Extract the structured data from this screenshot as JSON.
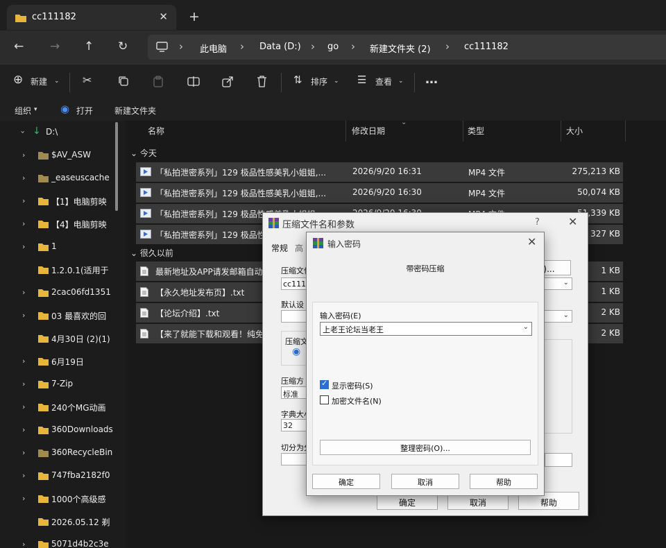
{
  "explorer": {
    "tab_title": "cc111182",
    "breadcrumbs": [
      "此电脑",
      "Data (D:)",
      "go",
      "新建文件夹 (2)",
      "cc111182"
    ],
    "commands": {
      "new": "新建",
      "sort": "排序",
      "view": "查看",
      "more": "…"
    },
    "subbar": {
      "organize": "组织",
      "open": "打开",
      "new_folder": "新建文件夹"
    },
    "tree": {
      "root": "D:\\",
      "items": [
        "$AV_ASW",
        "_easeuscache",
        "【1】电脑剪映",
        "【4】电脑剪映",
        "1",
        "1.2.0.1(适用于",
        "2cac06fd1351",
        "03 最喜欢的回",
        "4月30日 (2)(1)",
        "6月19日",
        "7-Zip",
        "240个MG动画",
        "360Downloads",
        "360RecycleBin",
        "747fba2182f0",
        "1000个高级感",
        "2026.05.12 剃",
        "5071d4b2c3e"
      ]
    },
    "columns": {
      "name": "名称",
      "date": "修改日期",
      "type": "类型",
      "size": "大小"
    },
    "groups": {
      "today": "今天",
      "older": "很久以前"
    },
    "today_files": [
      {
        "name": "「私拍泄密系列」129 极品性感美乳小姐姐,...",
        "date": "2026/9/20 16:31",
        "type": "MP4 文件",
        "size": "275,213 KB"
      },
      {
        "name": "「私拍泄密系列」129 极品性感美乳小姐姐,...",
        "date": "2026/9/20 16:30",
        "type": "MP4 文件",
        "size": "50,074 KB"
      },
      {
        "name": "「私拍泄密系列」129 极品性感美乳小姐姐,...",
        "date": "2026/9/20 16:30",
        "type": "MP4 文件",
        "size": "51,339 KB"
      },
      {
        "name": "「私拍泄密系列」129 极品性",
        "date": "",
        "type": "",
        "size": "327 KB"
      }
    ],
    "older_files": [
      {
        "name": "最新地址及APP请发邮箱自动",
        "size": "1 KB"
      },
      {
        "name": "【永久地址发布页】.txt",
        "size": "1 KB"
      },
      {
        "name": "【论坛介绍】.txt",
        "size": "2 KB"
      },
      {
        "name": "【来了就能下载和观看！纯免",
        "size": "2 KB"
      }
    ]
  },
  "archive_dialog": {
    "title": "压缩文件名和参数",
    "help": "?",
    "tabs": [
      "常规",
      "高"
    ],
    "labels": {
      "archive_name": "压缩文件",
      "name_value": "cc1111",
      "default": "默认设",
      "format": "压缩文",
      "method": "压缩方",
      "method_value": "标准",
      "dict": "字典大小",
      "dict_value": "32",
      "split": "切分为分"
    },
    "browse": "浏览(B)...",
    "ok": "确定",
    "cancel": "取消",
    "help_btn": "帮助"
  },
  "password_dialog": {
    "title": "输入密码",
    "heading": "带密码压缩",
    "input_label": "输入密码(E)",
    "password_value": "上老王论坛当老王",
    "show_password": "显示密码(S)",
    "show_password_checked": true,
    "encrypt_names": "加密文件名(N)",
    "encrypt_names_checked": false,
    "organize": "整理密码(O)...",
    "ok": "确定",
    "cancel": "取消",
    "help": "帮助"
  }
}
